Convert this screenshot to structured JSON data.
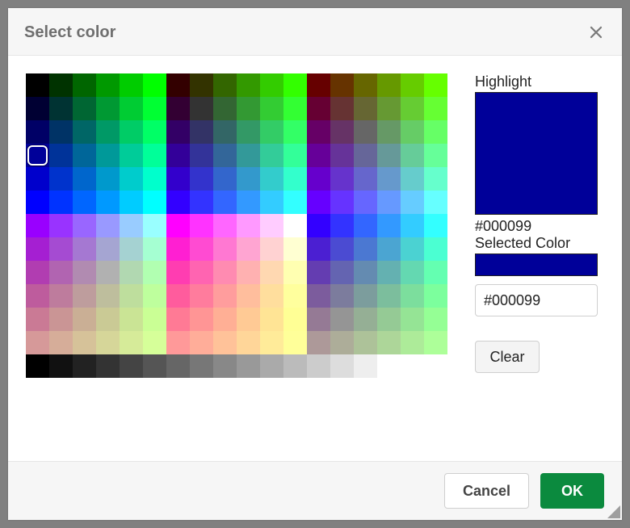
{
  "dialog": {
    "title": "Select color"
  },
  "side": {
    "highlight_label": "Highlight",
    "highlight_color": "#000099",
    "highlight_hex_label": "#000099",
    "selected_label": "Selected Color",
    "selected_color": "#000099",
    "hex_input_value": "#000099",
    "clear_label": "Clear"
  },
  "footer": {
    "cancel_label": "Cancel",
    "ok_label": "OK"
  },
  "palette": {
    "blocks": 3,
    "block_cols": 6,
    "block_rows": 12,
    "block_reds": [
      "00",
      "33",
      "66"
    ],
    "steps": [
      "00",
      "33",
      "66",
      "99",
      "CC",
      "FF"
    ],
    "gray_steps": [
      "00",
      "11",
      "22",
      "33",
      "44",
      "55",
      "66",
      "77",
      "88",
      "99",
      "AA",
      "BB",
      "CC",
      "DD",
      "EE",
      "FF",
      "FF",
      "FF"
    ],
    "selected_index": {
      "block": 0,
      "row": 3,
      "col": 0
    }
  }
}
